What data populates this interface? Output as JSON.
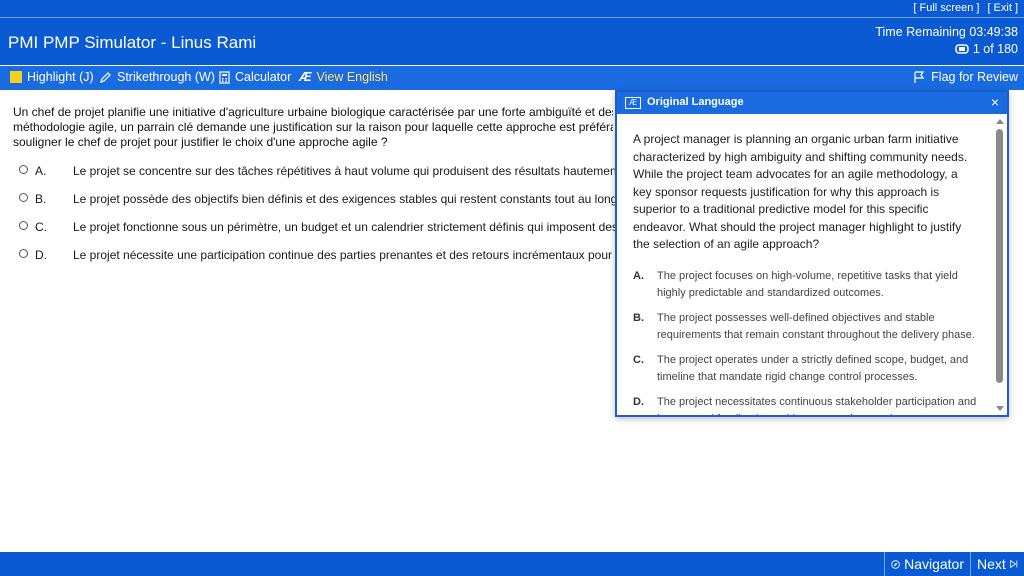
{
  "window": {
    "full_screen_label": "[ Full screen ]",
    "exit_label": "[ Exit ]"
  },
  "header": {
    "title": "PMI PMP Simulator - Linus Rami",
    "time_remaining": "Time Remaining 03:49:38",
    "progress": "1 of 180"
  },
  "toolbar": {
    "highlight_label": "Highlight (J)",
    "strikethrough_label": "Strikethrough (W)",
    "calculator_label": "Calculator",
    "view_english_label": "View English",
    "flag_label": "Flag for Review",
    "highlight_color": "#f3cf20",
    "view_english_color": "#ffe07a"
  },
  "question": {
    "lines": [
      "Un chef de projet planifie une initiative d'agriculture urbaine biologique caractérisée par une forte ambiguïté et des besoins changeants de la communauté. Alors que l'équipe plaide pour une",
      "méthodologie agile, un parrain clé demande une justification sur la raison pour laquelle cette approche est préférable à un modèle prédictif traditionnel pour cette entreprise spécifique. Que doit",
      "souligner le chef de projet pour justifier le choix d'une approche agile ?"
    ],
    "options": [
      {
        "letter": "A.",
        "text": "Le projet se concentre sur des tâches répétitives à haut volume qui produisent des résultats hautement prévisibles et standardisés."
      },
      {
        "letter": "B.",
        "text": "Le projet possède des objectifs bien définis et des exigences stables qui restent constants tout au long de la phase de livraison."
      },
      {
        "letter": "C.",
        "text": "Le projet fonctionne sous un périmètre, un budget et un calendrier strictement définis qui imposent des processus rigides de contrôle des changements."
      },
      {
        "letter": "D.",
        "text": "Le projet nécessite une participation continue des parties prenantes et des retours incrémentaux pour répondre aux exigences émergentes."
      }
    ]
  },
  "panel": {
    "icon": "Æ",
    "title": "Original Language",
    "close_glyph": "×",
    "question": "A project manager is planning an organic urban farm initiative characterized by high ambiguity and shifting community needs. While the project team advocates for an agile methodology, a key sponsor requests justification for why this approach is superior to a traditional predictive model for this specific endeavor. What should the project manager highlight to justify the selection of an agile approach?",
    "options": [
      {
        "letter": "A.",
        "text": "The project focuses on high-volume, repetitive tasks that yield highly predictable and standardized outcomes."
      },
      {
        "letter": "B.",
        "text": "The project possesses well-defined objectives and stable requirements that remain constant throughout the delivery phase."
      },
      {
        "letter": "C.",
        "text": "The project operates under a strictly defined scope, budget, and timeline that mandate rigid change control processes."
      },
      {
        "letter": "D.",
        "text": "The project necessitates continuous stakeholder participation and incremental feedback to address emerging requirements."
      }
    ]
  },
  "footer": {
    "navigator_label": "Navigator",
    "next_label": "Next"
  }
}
